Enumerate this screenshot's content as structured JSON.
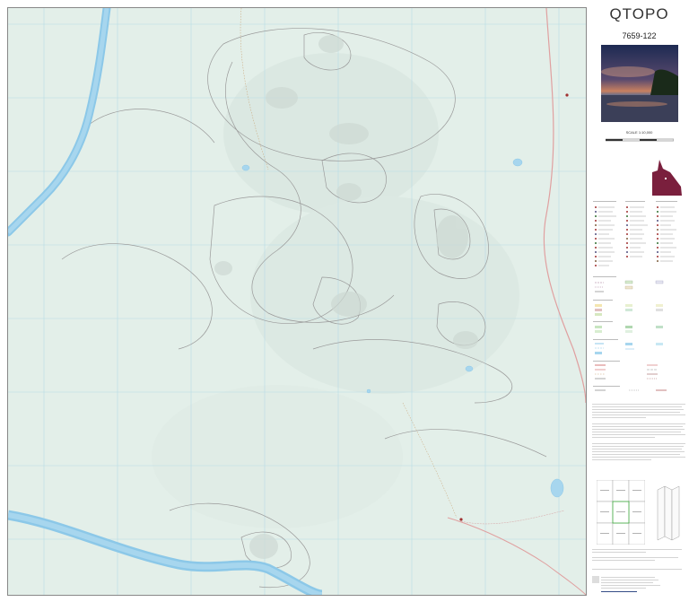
{
  "panel": {
    "title": "QTOPO",
    "sheet_number": "7659-122",
    "scale": "SCALE 1:10,000"
  },
  "colors": {
    "map_background": "#e3efe9",
    "river": "#8cc8e8",
    "contour": "#9a9a9a",
    "road": "#e0a0a0",
    "grid": "#b8dbe6",
    "state_shape": "#7a1f3d"
  }
}
